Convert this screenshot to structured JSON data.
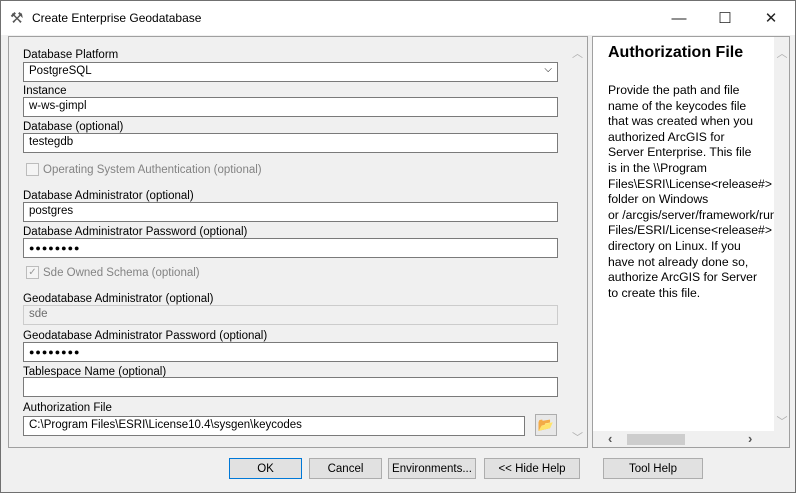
{
  "window": {
    "title": "Create Enterprise Geodatabase",
    "minimize": "—",
    "maximize": "☐",
    "close": "✕"
  },
  "form": {
    "platform_label": "Database Platform",
    "platform_value": "PostgreSQL",
    "instance_label": "Instance",
    "instance_value": "w-ws-gimpl",
    "database_label": "Database (optional)",
    "database_value": "testegdb",
    "os_auth_label": "Operating System Authentication (optional)",
    "os_auth_checked": false,
    "dba_label": "Database Administrator (optional)",
    "dba_value": "postgres",
    "dba_pw_label": "Database Administrator Password (optional)",
    "dba_pw_value": "●●●●●●●●",
    "sde_schema_label": "Sde Owned Schema (optional)",
    "sde_schema_checked": true,
    "sde_check_mark": "✓",
    "gdb_admin_label": "Geodatabase Administrator (optional)",
    "gdb_admin_value": "sde",
    "gdb_pw_label": "Geodatabase Administrator Password (optional)",
    "gdb_pw_value": "●●●●●●●●",
    "tablespace_label": "Tablespace Name (optional)",
    "tablespace_value": "",
    "auth_label": "Authorization File",
    "auth_value": "C:\\Program Files\\ESRI\\License10.4\\sysgen\\keycodes"
  },
  "help": {
    "title": "Authorization File",
    "lines": [
      "Provide the path and file",
      "name of the keycodes file",
      "that was created when you",
      "authorized ArcGIS for",
      "Server Enterprise. This file",
      "is in the \\\\Program",
      "Files\\ESRI\\License<release#>",
      "folder on Windows",
      "or /arcgis/server/framework/runtime/.wine/drive_c/Program",
      "Files/ESRI/License<release#>",
      "directory on Linux. If you",
      "have not already done so,",
      "authorize ArcGIS for Server",
      "to create this file."
    ]
  },
  "buttons": {
    "ok": "OK",
    "cancel": "Cancel",
    "environments": "Environments...",
    "hide_help": "<< Hide Help",
    "tool_help": "Tool Help"
  }
}
